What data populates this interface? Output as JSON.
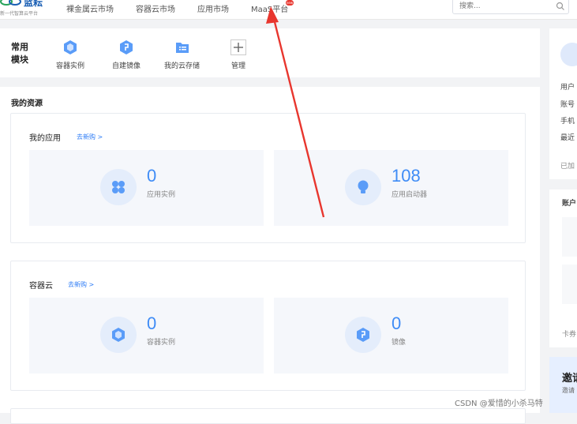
{
  "header": {
    "logo_text": "蓝耘",
    "logo_sub": "新一代智算云平台",
    "nav": [
      {
        "label": "裸金属云市场"
      },
      {
        "label": "容器云市场"
      },
      {
        "label": "应用市场"
      },
      {
        "label": "MaaS平台"
      }
    ],
    "badge": "new",
    "search_placeholder": "搜索..."
  },
  "common_modules": {
    "title": "常用模块",
    "items": [
      {
        "label": "容器实例",
        "icon": "container-instance-icon"
      },
      {
        "label": "自建镜像",
        "icon": "custom-image-icon"
      },
      {
        "label": "我的云存储",
        "icon": "cloud-storage-icon"
      },
      {
        "label": "管理",
        "icon": "plus-icon"
      }
    ]
  },
  "resources": {
    "title": "我的资源",
    "apps": {
      "title": "我的应用",
      "link": "去新购 >",
      "tiles": [
        {
          "value": "0",
          "label": "应用实例",
          "icon": "app-grid-icon"
        },
        {
          "value": "108",
          "label": "应用启动器",
          "icon": "lightbulb-icon"
        }
      ]
    },
    "container": {
      "title": "容器云",
      "link": "去新购 >",
      "tiles": [
        {
          "value": "0",
          "label": "容器实例",
          "icon": "container-instance-icon"
        },
        {
          "value": "0",
          "label": "镜像",
          "icon": "image-icon"
        }
      ]
    }
  },
  "profile_panel": {
    "lines": [
      "用户",
      "账号",
      "手机",
      "最近",
      "已加"
    ]
  },
  "account_panel": {
    "title": "账户",
    "footer": "卡券"
  },
  "invite_panel": {
    "title": "邀请",
    "sub": "邀请"
  },
  "watermark": "CSDN @爱惜的小杀马特",
  "colors": {
    "accent": "#3f8cf6",
    "annotation_arrow": "#e8362e"
  }
}
